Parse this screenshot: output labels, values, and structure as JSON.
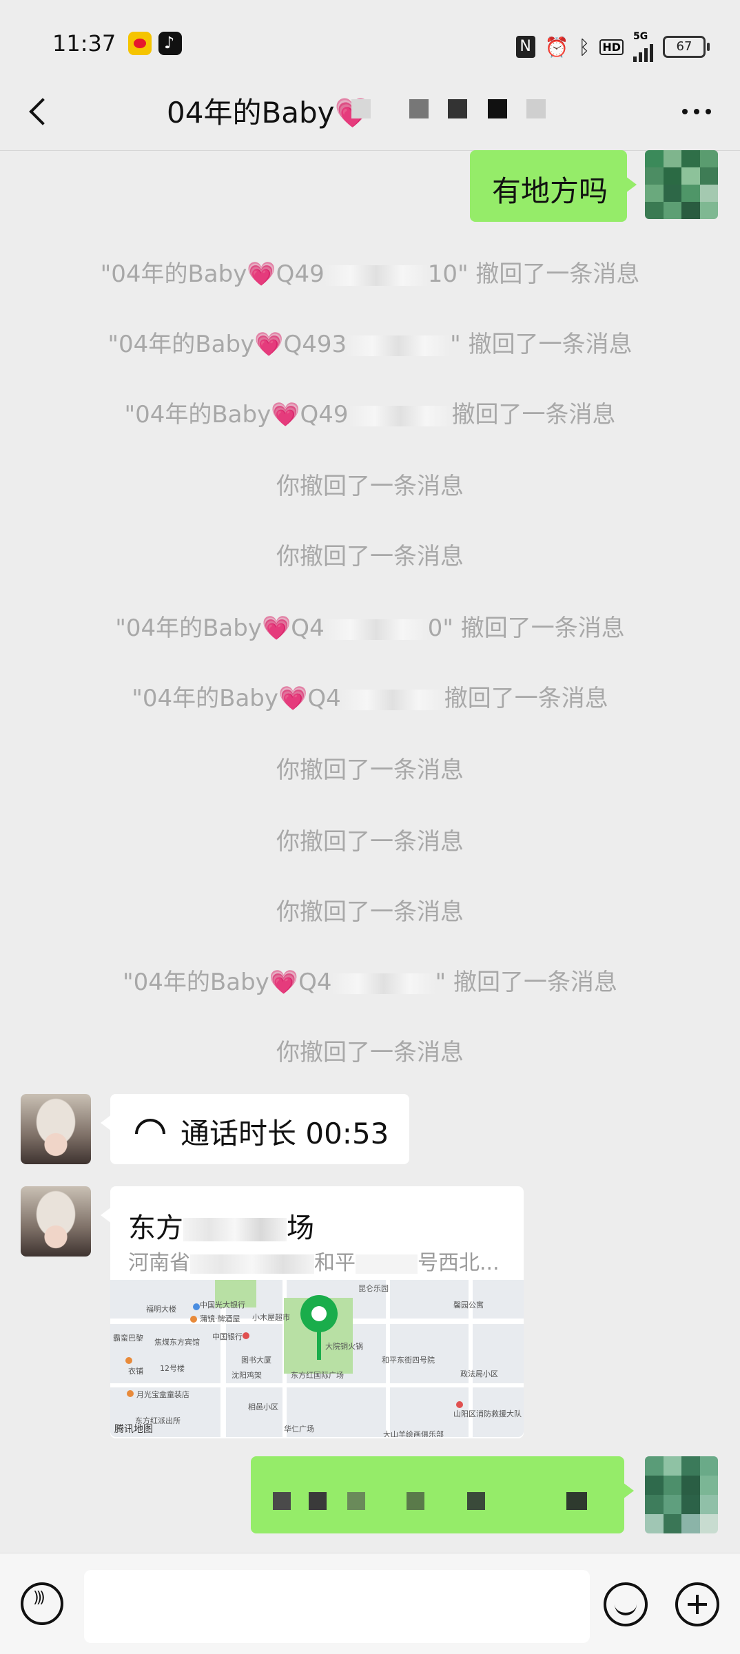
{
  "status_bar": {
    "time": "11:37",
    "network": "5G",
    "hd_label": "HD",
    "nfc_label": "N",
    "battery": "67"
  },
  "header": {
    "title": "04年的Baby💗"
  },
  "messages": {
    "m1_text": "有地方吗",
    "sys1": "\"04年的Baby💗Q49",
    "sys1_tail": "10\" 撤回了一条消息",
    "sys2": "\"04年的Baby💗Q493",
    "sys2_tail": "\" 撤回了一条消息",
    "sys3": "\"04年的Baby💗Q49",
    "sys3_tail": "撤回了一条消息",
    "you_recalled": "你撤回了一条消息",
    "sys6": "\"04年的Baby💗Q4",
    "sys6_tail": "0\" 撤回了一条消息",
    "sys7": "\"04年的Baby💗Q4",
    "sys7_tail": "撤回了一条消息",
    "sys11": "\"04年的Baby💗Q4",
    "sys11_tail": "\" 撤回了一条消息",
    "call_text": "通话时长 00:53",
    "location_title": "东方",
    "location_title_tail": "场",
    "location_addr": "河南省",
    "location_addr_mid": "和平",
    "location_addr_tail": "号西北...",
    "map_brand": "腾讯地图"
  },
  "map_labels": {
    "l1": "福明大楼",
    "l2": "中国光大银行",
    "l3": "蒲镜·牌酒屋",
    "l4": "小木屋超市",
    "l5": "中国银行",
    "l6": "东方红国际广场",
    "l7": "大院铜火锅",
    "l8": "和平东街四号院",
    "l9": "政法局小区",
    "l10": "图书大厦",
    "l11": "沈阳鸡架",
    "l12": "月光宝盒童装店",
    "l13": "东方红派出所",
    "l14": "华仁广场",
    "l15": "山阳区消防救援大队",
    "l16": "大山羊绘画俱乐部",
    "l17": "馨园公寓",
    "l18": "焦煤东方宾馆",
    "l19": "霸蛮巴黎",
    "l20": "衣铺",
    "l21": "12号楼",
    "l22": "相邑小区",
    "l23": "昆仑乐园"
  }
}
